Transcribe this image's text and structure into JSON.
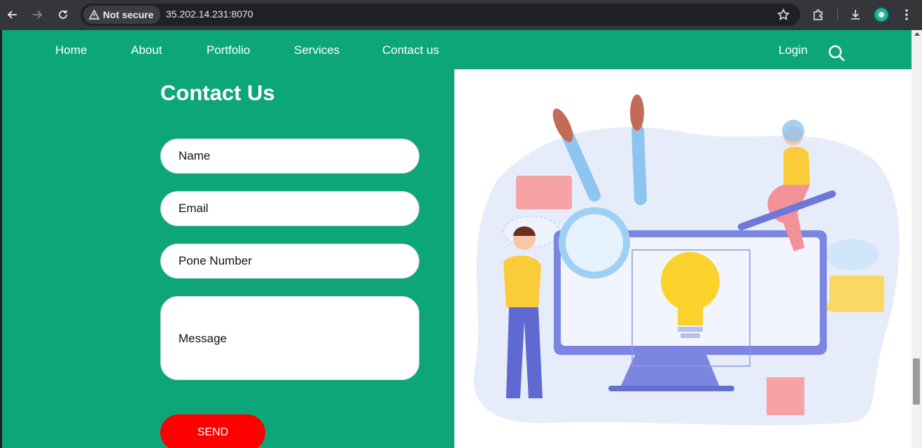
{
  "browser": {
    "security_label": "Not secure",
    "url": "35.202.14.231:8070"
  },
  "site_nav": {
    "items": [
      "Home",
      "About",
      "Portfolio",
      "Services",
      "Contact us"
    ],
    "login_label": "Login"
  },
  "contact": {
    "title": "Contact Us",
    "name_placeholder": "Name",
    "email_placeholder": "Email",
    "phone_placeholder": "Pone Number",
    "message_placeholder": "Message",
    "send_label": "SEND"
  },
  "colors": {
    "brand_green": "#0da678",
    "send_red": "#fe0000",
    "chrome_bg": "#35363a"
  }
}
